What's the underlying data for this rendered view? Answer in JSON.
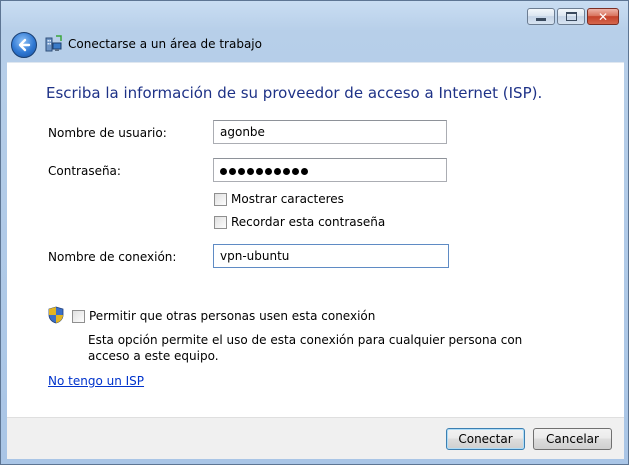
{
  "window": {
    "title": "Conectarse a un área de trabajo",
    "caption_buttons": {
      "minimize_icon": "minimize-icon",
      "maximize_icon": "maximize-icon",
      "close_glyph": "✕"
    }
  },
  "content": {
    "heading": "Escriba la información de su proveedor de acceso a Internet (ISP).",
    "username": {
      "label": "Nombre de usuario:",
      "value": "agonbe"
    },
    "password": {
      "label": "Contraseña:",
      "masked_length": 10
    },
    "show_chars": {
      "label": "Mostrar caracteres",
      "checked": false
    },
    "remember_password": {
      "label": "Recordar esta contraseña",
      "checked": false
    },
    "connection_name": {
      "label": "Nombre de conexión:",
      "value": "vpn-ubuntu"
    },
    "allow_others": {
      "label": "Permitir que otras personas usen esta conexión",
      "checked": false,
      "description": "Esta opción permite el uso de esta conexión para cualquier persona con acceso a este equipo."
    },
    "no_isp_link": "No tengo un ISP"
  },
  "footer": {
    "connect_label": "Conectar",
    "cancel_label": "Cancelar"
  }
}
